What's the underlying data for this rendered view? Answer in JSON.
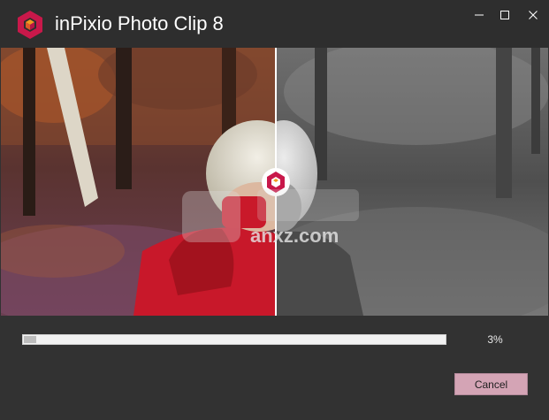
{
  "window": {
    "title": "inPixio Photo Clip 8"
  },
  "title_bar_controls": {
    "minimize_icon": "minimize-icon",
    "maximize_icon": "maximize-icon",
    "close_icon": "close-icon"
  },
  "watermark": {
    "text": "anxz.com"
  },
  "progress": {
    "value": 0.03,
    "label": "3%"
  },
  "buttons": {
    "cancel_label": "Cancel"
  },
  "colors": {
    "brand": "#c8184a",
    "accent_orange": "#f29a1f",
    "cancel_button": "#d4a4b5",
    "window_background": "#323232"
  }
}
